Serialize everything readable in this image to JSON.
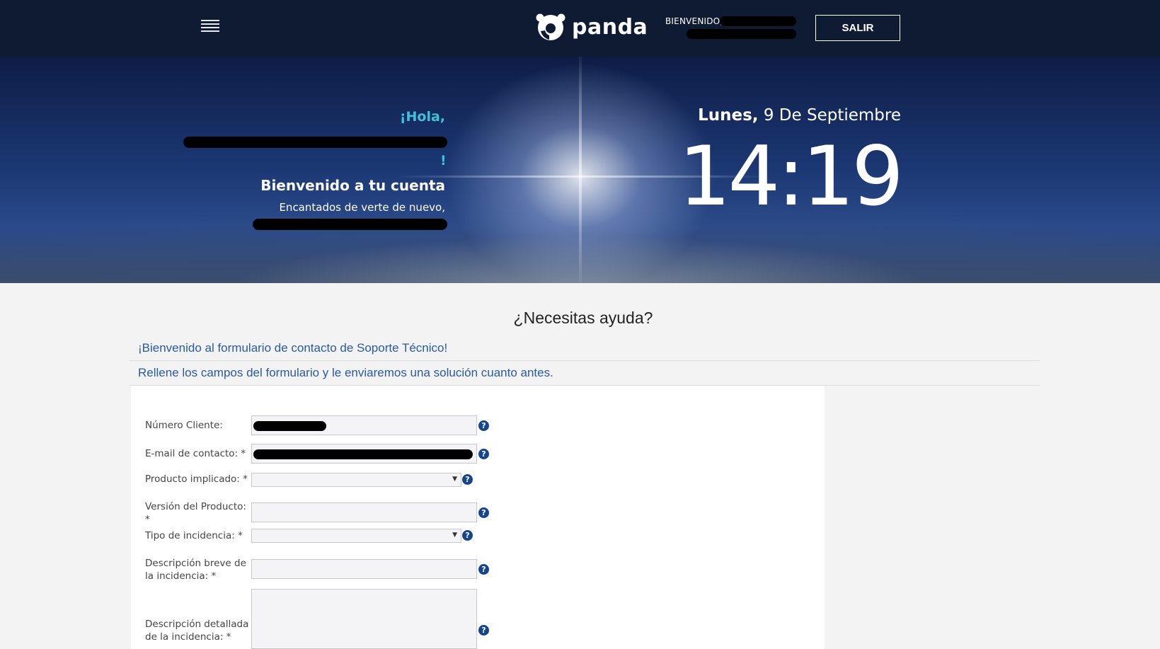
{
  "header": {
    "logo_text": "panda",
    "welcome_label": "BIENVENIDO,",
    "logout_label": "SALIR"
  },
  "hero": {
    "greeting": "¡Hola,",
    "greeting_end": "!",
    "welcome_title": "Bienvenido a tu cuenta",
    "welcome_subtitle": "Encantados de verte de nuevo,",
    "date_day": "Lunes,",
    "date_rest": "9 De Septiembre",
    "time": "14:19"
  },
  "help": {
    "title": "¿Necesitas ayuda?",
    "intro_1": "¡Bienvenido al formulario de contacto de Soporte Técnico!",
    "intro_2": "Rellene los campos del formulario y le enviaremos una solución cuanto antes."
  },
  "form": {
    "client_number_label": "Número Cliente:",
    "email_label": "E-mail de contacto: *",
    "product_label": "Producto implicado: *",
    "version_label": "Versión del Producto: *",
    "incident_type_label": "Tipo de incidencia: *",
    "short_desc_label": "Descripción breve de la incidencia: *",
    "long_desc_label": "Descripción detallada de la incidencia: *",
    "help_glyph": "?",
    "select_arrow": "▼"
  },
  "colors": {
    "header_bg": "#0f1a33",
    "accent_cyan": "#3fc1d8",
    "link_blue": "#2a5aa0",
    "help_icon_blue": "#14458e"
  }
}
